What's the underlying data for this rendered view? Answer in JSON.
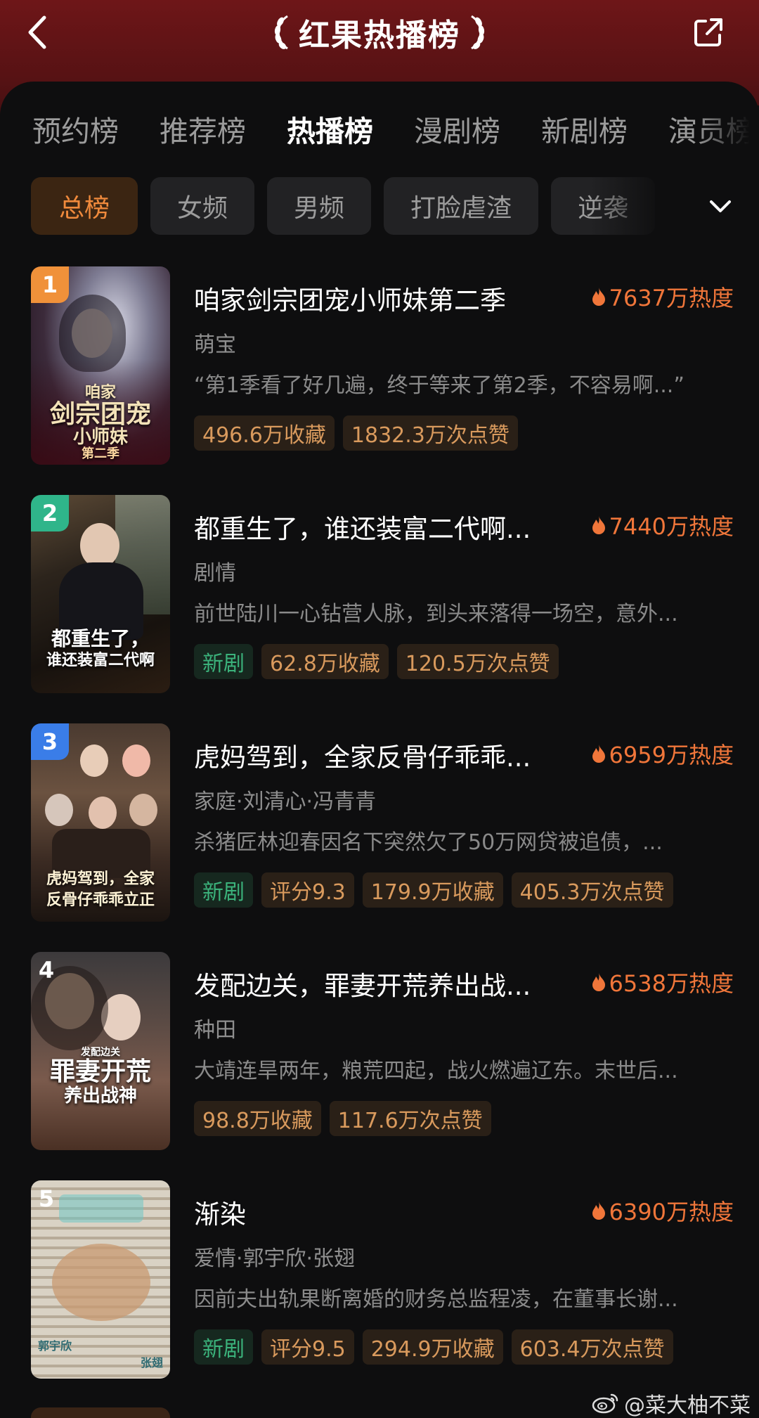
{
  "header": {
    "title": "红果热播榜",
    "colors": {
      "top": "#6e1618",
      "accent": "#f0763a"
    }
  },
  "tabs": [
    {
      "label": "预约榜",
      "active": false
    },
    {
      "label": "推荐榜",
      "active": false
    },
    {
      "label": "热播榜",
      "active": true
    },
    {
      "label": "漫剧榜",
      "active": false
    },
    {
      "label": "新剧榜",
      "active": false
    },
    {
      "label": "演员榜",
      "active": false
    }
  ],
  "chips": [
    {
      "label": "总榜",
      "active": true
    },
    {
      "label": "女频",
      "active": false
    },
    {
      "label": "男频",
      "active": false
    },
    {
      "label": "打脸虐渣",
      "active": false
    },
    {
      "label": "逆袭",
      "active": false
    }
  ],
  "items": [
    {
      "rank": "1",
      "name": "咱家剑宗团宠小师妹第二季",
      "heat": "7637万热度",
      "tags": "萌宝",
      "desc": "“第1季看了好几遍，终于等来了第2季，不容易啊...”",
      "badges": [
        "496.6万收藏",
        "1832.3万次点赞"
      ],
      "is_new": false,
      "poster_text": [
        "咱家",
        "剑宗团宠",
        "小师妹",
        "第二季"
      ]
    },
    {
      "rank": "2",
      "name": "都重生了，谁还装富二代啊...",
      "heat": "7440万热度",
      "tags": "剧情",
      "desc": "前世陆川一心钻营人脉，到头来落得一场空，意外...",
      "badges": [
        "新剧",
        "62.8万收藏",
        "120.5万次点赞"
      ],
      "is_new": true,
      "poster_text": [
        "都重生了，",
        "谁还装富二代啊"
      ]
    },
    {
      "rank": "3",
      "name": "虎妈驾到，全家反骨仔乖乖...",
      "heat": "6959万热度",
      "tags": "家庭·刘清心·冯青青",
      "desc": "杀猪匠林迎春因名下突然欠了50万网贷被追债，...",
      "badges": [
        "新剧",
        "评分9.3",
        "179.9万收藏",
        "405.3万次点赞"
      ],
      "is_new": true,
      "poster_text": [
        "虎妈驾到，全家",
        "反骨仔乖乖立正"
      ]
    },
    {
      "rank": "4",
      "name": "发配边关，罪妻开荒养出战...",
      "heat": "6538万热度",
      "tags": "种田",
      "desc": "大靖连旱两年，粮荒四起，战火燃遍辽东。末世后...",
      "badges": [
        "98.8万收藏",
        "117.6万次点赞"
      ],
      "is_new": false,
      "poster_text": [
        "发配边关",
        "罪妻开荒",
        "养出战神"
      ]
    },
    {
      "rank": "5",
      "name": "渐染",
      "heat": "6390万热度",
      "tags": "爱情·郭宇欣·张翅",
      "desc": "因前夫出轨果断离婚的财务总监程凌，在董事长谢...",
      "badges": [
        "新剧",
        "评分9.5",
        "294.9万收藏",
        "603.4万次点赞"
      ],
      "is_new": true,
      "poster_text": [
        "郭宇欣",
        "张翅"
      ]
    }
  ],
  "watermark": "@菜大柚不菜"
}
